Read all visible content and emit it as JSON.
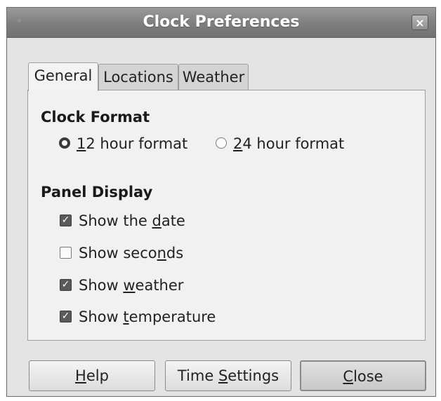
{
  "window": {
    "title": "Clock Preferences",
    "close_glyph": "×"
  },
  "tabs": [
    {
      "label": "General",
      "active": true
    },
    {
      "label": "Locations",
      "active": false
    },
    {
      "label": "Weather",
      "active": false
    }
  ],
  "clock_format": {
    "heading": "Clock Format",
    "options": [
      {
        "label_mnemonic": "1",
        "label_rest": "2 hour format",
        "selected": true
      },
      {
        "label_mnemonic": "2",
        "label_rest": "4 hour format",
        "selected": false
      }
    ]
  },
  "panel_display": {
    "heading": "Panel Display",
    "items": [
      {
        "label_pre": "Show the ",
        "label_mnemonic": "d",
        "label_post": "ate",
        "checked": true
      },
      {
        "label_pre": "Show seco",
        "label_mnemonic": "n",
        "label_post": "ds",
        "checked": false
      },
      {
        "label_pre": "Show ",
        "label_mnemonic": "w",
        "label_post": "eather",
        "checked": true
      },
      {
        "label_pre": "Show ",
        "label_mnemonic": "t",
        "label_post": "emperature",
        "checked": true
      }
    ]
  },
  "buttons": {
    "help": {
      "mnemonic": "H",
      "rest": "elp"
    },
    "time_settings": {
      "pre": "Time ",
      "mnemonic": "S",
      "rest": "ettings"
    },
    "close": {
      "mnemonic": "C",
      "rest": "lose"
    }
  },
  "icons": {
    "title_icon": "window-menu-icon",
    "check_glyph": "✓"
  }
}
